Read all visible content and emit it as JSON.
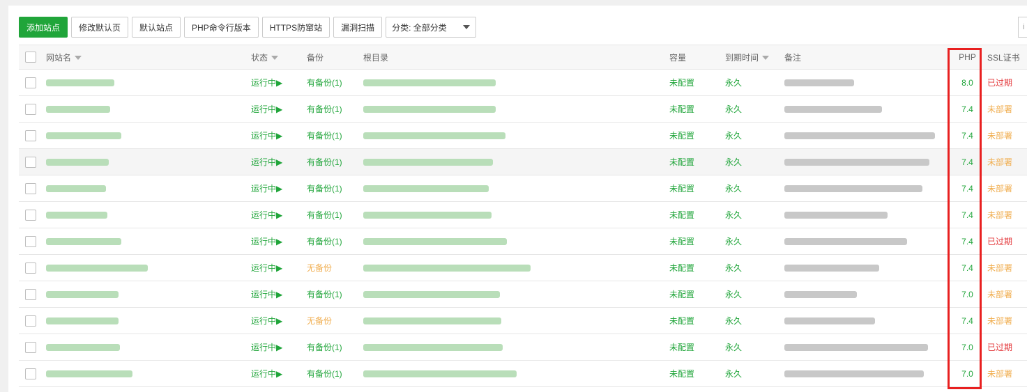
{
  "toolbar": {
    "add_site": "添加站点",
    "modify_default_page": "修改默认页",
    "default_site": "默认站点",
    "php_cli_version": "PHP命令行版本",
    "https_protect": "HTTPS防窜站",
    "vuln_scan": "漏洞扫描",
    "category_select": "分类: 全部分类"
  },
  "columns": {
    "site_name": "网站名",
    "status": "状态",
    "backup": "备份",
    "root_dir": "根目录",
    "capacity": "容量",
    "expire": "到期时间",
    "remark": "备注",
    "php": "PHP",
    "ssl": "SSL证书"
  },
  "rows": [
    {
      "status": "运行中▶",
      "backup": "有备份(1)",
      "backup_color": "#20a53a",
      "capacity": "未配置",
      "expire": "永久",
      "php": "8.0",
      "ssl": "已过期",
      "ssl_color": "#e4393c"
    },
    {
      "status": "运行中▶",
      "backup": "有备份(1)",
      "backup_color": "#20a53a",
      "capacity": "未配置",
      "expire": "永久",
      "php": "7.4",
      "ssl": "未部署",
      "ssl_color": "#f0ad4e"
    },
    {
      "status": "运行中▶",
      "backup": "有备份(1)",
      "backup_color": "#20a53a",
      "capacity": "未配置",
      "expire": "永久",
      "php": "7.4",
      "ssl": "未部署",
      "ssl_color": "#f0ad4e"
    },
    {
      "status": "运行中▶",
      "backup": "有备份(1)",
      "backup_color": "#20a53a",
      "capacity": "未配置",
      "expire": "永久",
      "php": "7.4",
      "ssl": "未部署",
      "ssl_color": "#f0ad4e"
    },
    {
      "status": "运行中▶",
      "backup": "有备份(1)",
      "backup_color": "#20a53a",
      "capacity": "未配置",
      "expire": "永久",
      "php": "7.4",
      "ssl": "未部署",
      "ssl_color": "#f0ad4e"
    },
    {
      "status": "运行中▶",
      "backup": "有备份(1)",
      "backup_color": "#20a53a",
      "capacity": "未配置",
      "expire": "永久",
      "php": "7.4",
      "ssl": "未部署",
      "ssl_color": "#f0ad4e"
    },
    {
      "status": "运行中▶",
      "backup": "有备份(1)",
      "backup_color": "#20a53a",
      "capacity": "未配置",
      "expire": "永久",
      "php": "7.4",
      "ssl": "已过期",
      "ssl_color": "#e4393c"
    },
    {
      "status": "运行中▶",
      "backup": "无备份",
      "backup_color": "#f0ad4e",
      "capacity": "未配置",
      "expire": "永久",
      "php": "7.4",
      "ssl": "未部署",
      "ssl_color": "#f0ad4e"
    },
    {
      "status": "运行中▶",
      "backup": "有备份(1)",
      "backup_color": "#20a53a",
      "capacity": "未配置",
      "expire": "永久",
      "php": "7.0",
      "ssl": "未部署",
      "ssl_color": "#f0ad4e"
    },
    {
      "status": "运行中▶",
      "backup": "无备份",
      "backup_color": "#f0ad4e",
      "capacity": "未配置",
      "expire": "永久",
      "php": "7.4",
      "ssl": "未部署",
      "ssl_color": "#f0ad4e"
    },
    {
      "status": "运行中▶",
      "backup": "有备份(1)",
      "backup_color": "#20a53a",
      "capacity": "未配置",
      "expire": "永久",
      "php": "7.0",
      "ssl": "已过期",
      "ssl_color": "#e4393c"
    },
    {
      "status": "运行中▶",
      "backup": "有备份(1)",
      "backup_color": "#20a53a",
      "capacity": "未配置",
      "expire": "永久",
      "php": "7.0",
      "ssl": "未部署",
      "ssl_color": "#f0ad4e"
    }
  ],
  "colors": {
    "accent": "#20a53a",
    "warning": "#f0ad4e",
    "danger": "#e4393c",
    "highlight_box": "#e82020"
  }
}
